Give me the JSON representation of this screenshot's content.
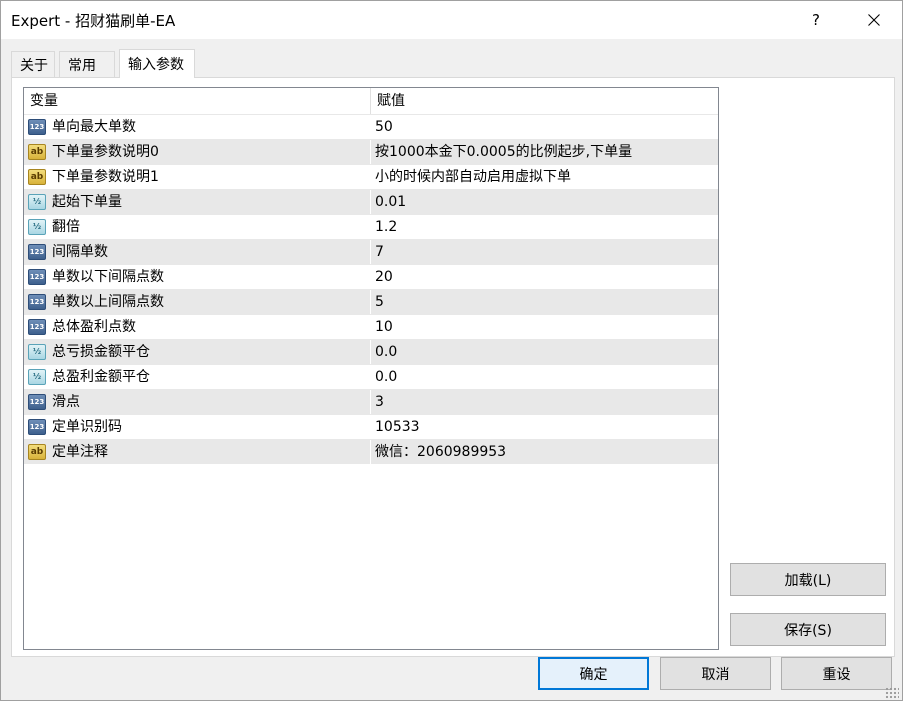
{
  "window": {
    "title": "Expert - 招财猫刷单-EA",
    "help_label": "?"
  },
  "tabs": [
    {
      "label": "关于"
    },
    {
      "label": "常用"
    },
    {
      "label": "输入参数"
    }
  ],
  "grid": {
    "columns": {
      "variable": "变量",
      "value": "赋值"
    },
    "rows": [
      {
        "type_icon": "int-type-icon",
        "type_text": "123",
        "name": "单向最大单数",
        "value": "50"
      },
      {
        "type_icon": "string-type-icon",
        "type_text": "ab",
        "name": "下单量参数说明0",
        "value": "按1000本金下0.0005的比例起步,下单量"
      },
      {
        "type_icon": "string-type-icon",
        "type_text": "ab",
        "name": "下单量参数说明1",
        "value": "小的时候内部自动启用虚拟下单"
      },
      {
        "type_icon": "double-type-icon",
        "type_text": "½",
        "name": "起始下单量",
        "value": "0.01"
      },
      {
        "type_icon": "double-type-icon",
        "type_text": "½",
        "name": "翻倍",
        "value": "1.2"
      },
      {
        "type_icon": "int-type-icon",
        "type_text": "123",
        "name": "间隔单数",
        "value": "7"
      },
      {
        "type_icon": "int-type-icon",
        "type_text": "123",
        "name": "单数以下间隔点数",
        "value": "20"
      },
      {
        "type_icon": "int-type-icon",
        "type_text": "123",
        "name": "单数以上间隔点数",
        "value": "5"
      },
      {
        "type_icon": "int-type-icon",
        "type_text": "123",
        "name": "总体盈利点数",
        "value": "10"
      },
      {
        "type_icon": "double-type-icon",
        "type_text": "½",
        "name": "总亏损金额平仓",
        "value": "0.0"
      },
      {
        "type_icon": "double-type-icon",
        "type_text": "½",
        "name": "总盈利金额平仓",
        "value": "0.0"
      },
      {
        "type_icon": "int-type-icon",
        "type_text": "123",
        "name": "滑点",
        "value": "3"
      },
      {
        "type_icon": "int-type-icon",
        "type_text": "123",
        "name": "定单识别码",
        "value": "10533"
      },
      {
        "type_icon": "string-type-icon",
        "type_text": "ab",
        "name": "定单注释",
        "value": "微信：2060989953"
      }
    ]
  },
  "buttons": {
    "load": "加载(L)",
    "save": "保存(S)",
    "ok": "确定",
    "cancel": "取消",
    "reset": "重设"
  },
  "colors": {
    "accent": "#0078d7",
    "row_alt": "#e8e8e8"
  }
}
